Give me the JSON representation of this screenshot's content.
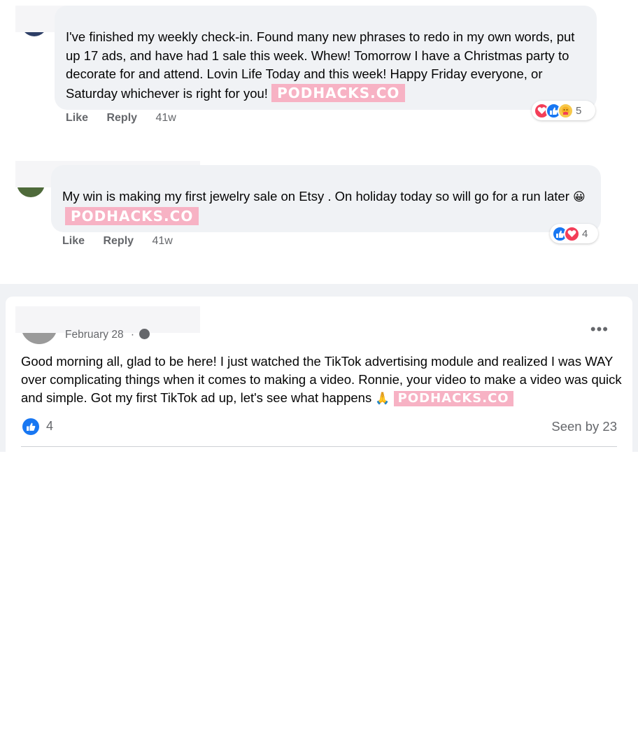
{
  "comments": [
    {
      "text": "I've finished my weekly check-in. Found many new phrases to redo in my own words, put up 17 ads, and have had 1 sale this week. Whew! Tomorrow I have a Christmas party to decorate for and attend. Lovin Life Today and this week! Happy Friday everyone, or Saturday whichever is right for you!",
      "watermark": "PODHACKS.CO",
      "actions": {
        "like": "Like",
        "reply": "Reply",
        "time": "41w"
      },
      "reactions": {
        "icons": [
          "heart-icon",
          "like-icon",
          "care-icon"
        ],
        "count": "5"
      }
    },
    {
      "text": "My win is making my first jewelry sale on Etsy . On holiday today so will go for a run later",
      "emoji": "😀",
      "watermark": "PODHACKS.CO",
      "actions": {
        "like": "Like",
        "reply": "Reply",
        "time": "41w"
      },
      "reactions": {
        "icons": [
          "like-icon",
          "heart-icon"
        ],
        "count": "4"
      }
    }
  ],
  "post": {
    "date": "February 28",
    "date_suffix": "·",
    "more": "•••",
    "text": "Good morning all, glad to be here!  I just watched the TikTok advertising module and realized I was WAY over complicating things when it comes to making a video. Ronnie, your video to make a video was quick and simple.  Got my first TikTok ad up,  let's see what happens",
    "emoji": "🙏",
    "watermark": "PODHACKS.CO",
    "like_count": "4",
    "seen_by": "Seen by 23"
  },
  "colors": {
    "like_blue": "#1877f2",
    "heart_red": "#f33e58",
    "watermark_pink": "#f7b2c4",
    "bubble_gray": "#f0f2f5"
  }
}
